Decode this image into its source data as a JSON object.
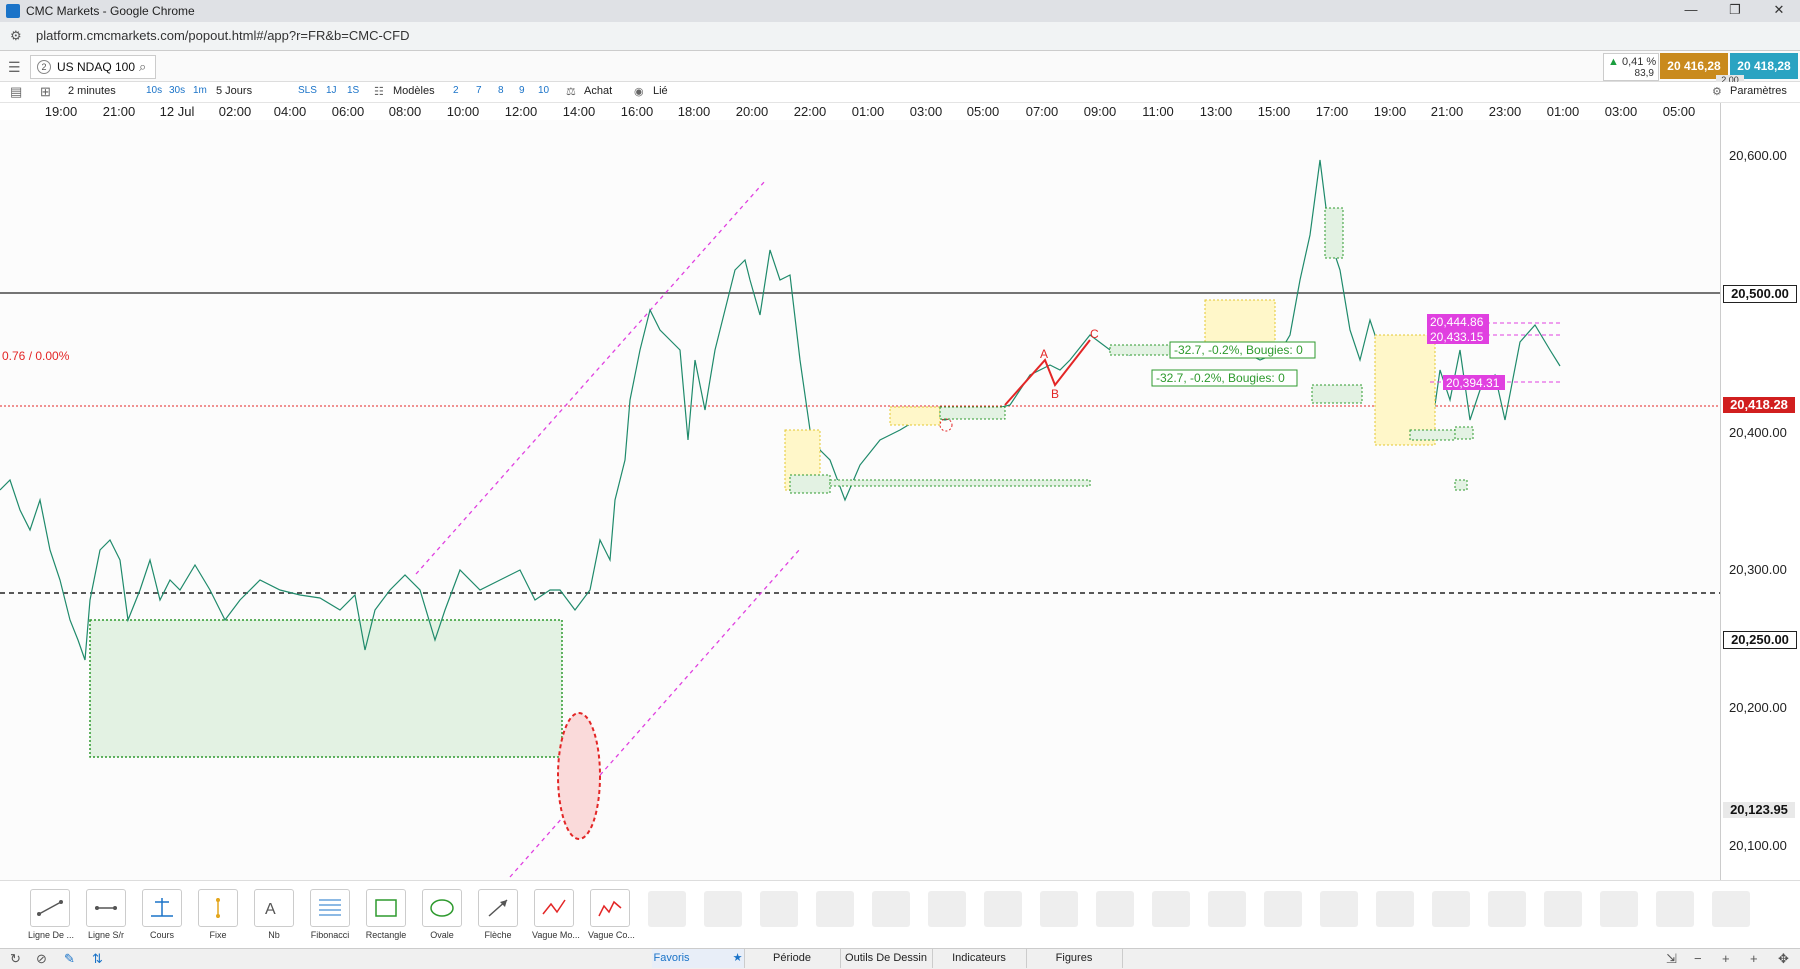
{
  "browser": {
    "window_title": "CMC Markets - Google Chrome",
    "url": "platform.cmcmarkets.com/popout.html#/app?r=FR&b=CMC-CFD",
    "controls": [
      "—",
      "❐",
      "✕"
    ]
  },
  "instrument": {
    "number": "2",
    "name": "US NDAQ 100",
    "change_pct": "0,41 %",
    "change_sub": "83,9",
    "sell": "20 416,28",
    "buy": "20 418,28",
    "spread": "2.00"
  },
  "toolbar": {
    "interval": "2 minutes",
    "intervals": [
      "10s",
      "30s",
      "1m"
    ],
    "range": "5 Jours",
    "quick_ranges": [
      "SLS",
      "1J",
      "1S"
    ],
    "templates_label": "Modèles",
    "numbers": [
      "2",
      "7",
      "8",
      "9",
      "10"
    ],
    "buy_label": "Achat",
    "link_label": "Lié",
    "settings_label": "Paramètres"
  },
  "time_axis": [
    "19:00",
    "21:00",
    "12 Jul",
    "02:00",
    "04:00",
    "06:00",
    "08:00",
    "10:00",
    "12:00",
    "14:00",
    "16:00",
    "18:00",
    "20:00",
    "22:00",
    "01:00",
    "03:00",
    "05:00",
    "07:00",
    "09:00",
    "11:00",
    "13:00",
    "15:00",
    "17:00",
    "19:00",
    "21:00",
    "23:00",
    "01:00",
    "03:00",
    "05:00"
  ],
  "price_axis": [
    "20,600.00",
    "20,400.00",
    "20,300.00",
    "20,200.00",
    "20,100.00"
  ],
  "price_tags": {
    "level_500": "20,500.00",
    "current": "20,418.28",
    "level_250": "20,250.00",
    "low": "20,123.95"
  },
  "chart_labels": {
    "fib_label": "0.76 / 0.00%",
    "wave_a": "A",
    "wave_b": "B",
    "wave_c": "C",
    "measure_1": "-32.7, -0.2%, Bougies: 0",
    "measure_2": "-32.7, -0.2%, Bougies: 0",
    "tag_1": "20,444.86",
    "tag_2": "20,433.15",
    "tag_3": "20,394.31"
  },
  "drawing_tools": [
    "Ligne De ...",
    "Ligne S/r",
    "Cours",
    "Fixe",
    "Nb",
    "Fibonacci",
    "Rectangle",
    "Ovale",
    "Flèche",
    "Vague Mo...",
    "Vague Co..."
  ],
  "bottom_tabs": [
    "Favoris",
    "Période",
    "Outils De Dessin",
    "Indicateurs",
    "Figures"
  ],
  "colors": {
    "sell": "#c98a1d",
    "buy": "#2aa3c2",
    "price_line": "#e32626",
    "fib_line": "#e040e0",
    "zone_green": "#3fae3f"
  }
}
